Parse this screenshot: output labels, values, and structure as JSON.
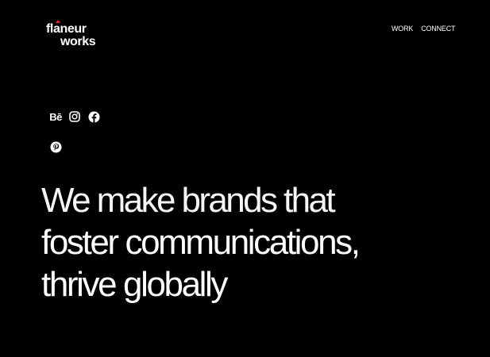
{
  "brand": {
    "line1": "flaneur",
    "line2": "works",
    "accent_color": "#e0262a"
  },
  "nav": {
    "items": [
      {
        "label": "WORK"
      },
      {
        "label": "CONNECT"
      }
    ]
  },
  "social": {
    "behance_label": "Bē",
    "icons": [
      "behance-icon",
      "instagram-icon",
      "facebook-icon",
      "pinterest-icon"
    ]
  },
  "hero": {
    "line1": "We make brands that",
    "line2": "foster communications,",
    "line3": "thrive globally"
  },
  "colors": {
    "background": "#000000",
    "text": "#ffffff"
  }
}
